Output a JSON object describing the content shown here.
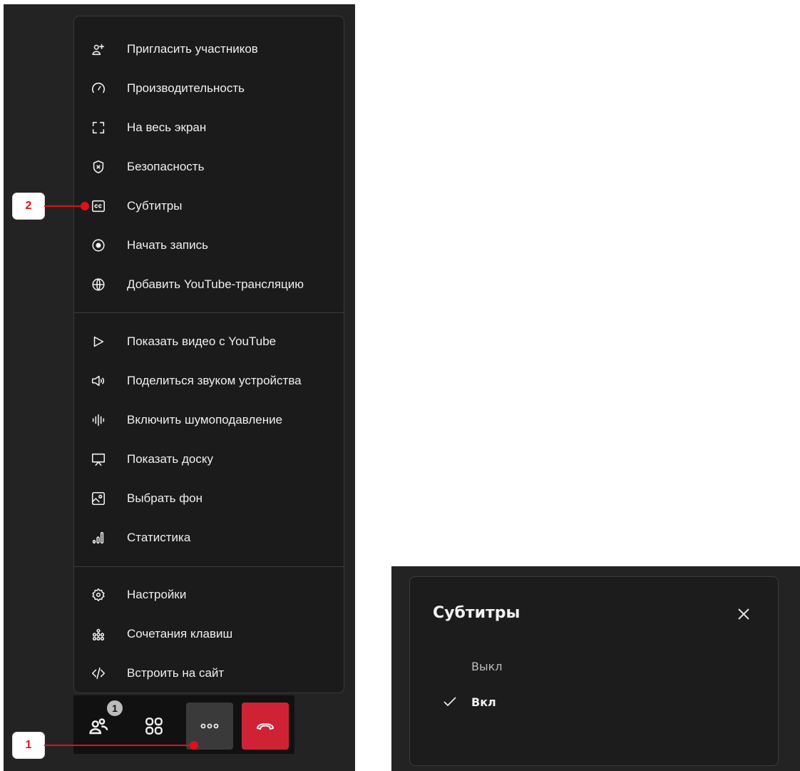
{
  "menu": {
    "items": [
      {
        "label": "Пригласить участников",
        "icon": "invite-user-icon"
      },
      {
        "label": "Производительность",
        "icon": "performance-gauge-icon"
      },
      {
        "label": "На весь экран",
        "icon": "fullscreen-icon"
      },
      {
        "label": "Безопасность",
        "icon": "shield-icon"
      },
      {
        "label": "Субтитры",
        "icon": "closed-captions-icon"
      },
      {
        "label": "Начать запись",
        "icon": "record-icon"
      },
      {
        "label": "Добавить YouTube-трансляцию",
        "icon": "globe-icon"
      },
      {
        "label": "Показать видео с YouTube",
        "icon": "play-icon"
      },
      {
        "label": "Поделиться звуком устройства",
        "icon": "speaker-icon"
      },
      {
        "label": "Включить шумоподавление",
        "icon": "noise-suppression-icon"
      },
      {
        "label": "Показать доску",
        "icon": "whiteboard-icon"
      },
      {
        "label": "Выбрать фон",
        "icon": "background-image-icon"
      },
      {
        "label": "Статистика",
        "icon": "statistics-icon"
      },
      {
        "label": "Настройки",
        "icon": "gear-icon"
      },
      {
        "label": "Сочетания клавиш",
        "icon": "shortcuts-icon"
      },
      {
        "label": "Встроить на сайт",
        "icon": "embed-code-icon"
      }
    ]
  },
  "toolbar": {
    "participants_badge": "1",
    "buttons": [
      "participants-icon",
      "grid-layout-icon",
      "more-icon",
      "end-call-icon"
    ]
  },
  "callouts": {
    "first": "1",
    "second": "2"
  },
  "subtitles_dialog": {
    "title": "Субтитры",
    "options": [
      {
        "label": "Выкл",
        "selected": false
      },
      {
        "label": "Вкл",
        "selected": true
      }
    ]
  },
  "colors": {
    "end_call": "#cf2335",
    "callout": "#e0101a",
    "menu_bg": "#1b1b1b"
  }
}
